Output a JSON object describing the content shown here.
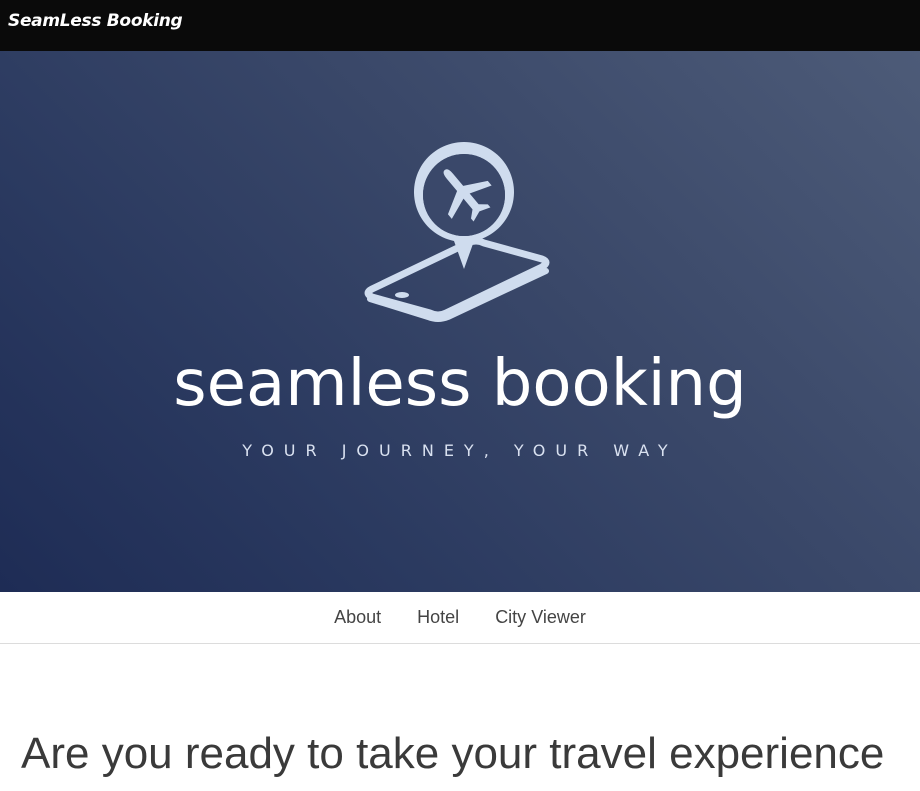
{
  "header": {
    "brand": "SeamLess Booking"
  },
  "hero": {
    "logo_icon": "map-pin-airplane-phone-icon",
    "title": "seamless booking",
    "tagline": "YOUR JOURNEY, YOUR WAY",
    "colors": {
      "gradient_light": "#4d5b78",
      "gradient_dark": "#1e2c55",
      "logo": "#cfdcee"
    }
  },
  "nav": {
    "items": [
      {
        "label": "About"
      },
      {
        "label": "Hotel"
      },
      {
        "label": "City Viewer"
      }
    ]
  },
  "main": {
    "headline": "Are you ready to take your travel experience"
  }
}
